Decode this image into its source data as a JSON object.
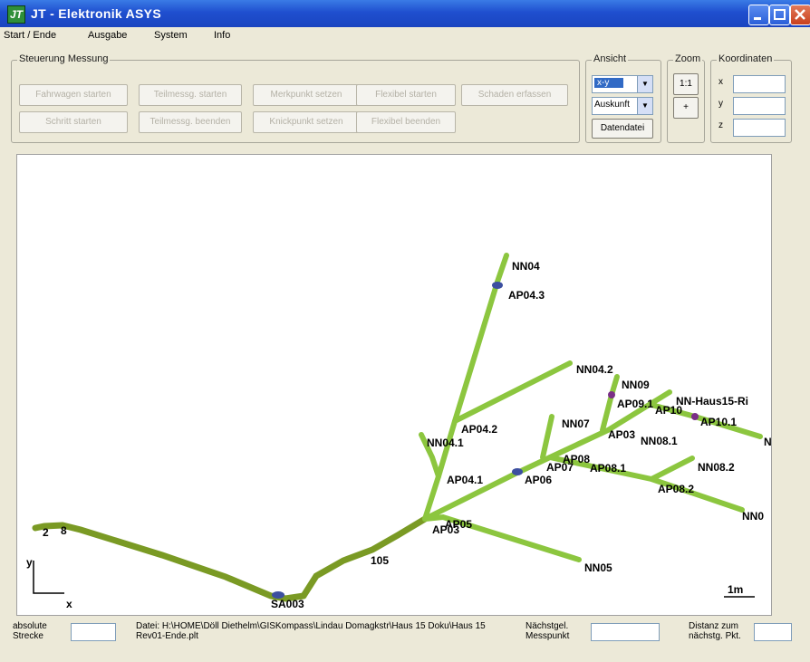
{
  "window": {
    "title": "JT - Elektronik  ASYS",
    "icon": "app-logo-icon",
    "controls": [
      "minimize-icon",
      "maximize-icon",
      "close-icon"
    ]
  },
  "menu": {
    "items": [
      "Start / Ende",
      "Ausgabe",
      "System",
      "Info"
    ]
  },
  "steuerung": {
    "label": "Steuerung Messung",
    "row1": [
      "Fahrwagen starten",
      "Teilmessg. starten",
      "Merkpunkt setzen",
      "Flexibel starten",
      "Schaden erfassen"
    ],
    "row2": [
      "Schritt starten",
      "Teilmessg. beenden",
      "Knickpunkt setzen",
      "Flexibel beenden"
    ]
  },
  "ansicht": {
    "label": "Ansicht",
    "projection": "x-y",
    "mode": "Auskunft",
    "datei_button": "Datendatei"
  },
  "zoom": {
    "label": "Zoom",
    "one_to_one": "1:1",
    "plus": "+"
  },
  "koordinaten": {
    "label": "Koordinaten",
    "axes": [
      "x",
      "y",
      "z"
    ],
    "values": [
      "",
      "",
      ""
    ]
  },
  "plot": {
    "colors": {
      "pipe": "#8cc63f",
      "main_pipe": "#7a9a24",
      "marker": "#3c4fa0",
      "marker2": "#7a2e86"
    },
    "axis_y": "y",
    "axis_x": "x",
    "scale": "1m",
    "labels": [
      "NN04",
      "AP04.3",
      "NN04.2",
      "NN09",
      "AP09.1",
      "NN-Haus15-Ri",
      "AP10",
      "AP10.1",
      "N",
      "NN07",
      "AP03",
      "NN08.1",
      "AP04.2",
      "NN04.1",
      "AP08",
      "AP07",
      "AP08.1",
      "NN08.2",
      "AP04.1",
      "AP06",
      "AP08.2",
      "NN0",
      "AP05",
      "AP03",
      "NN05",
      "105",
      "2",
      "8",
      "SA003"
    ]
  },
  "status": {
    "absolute_label": "absolute\nStrecke",
    "absolute_value": "",
    "file_text": "Datei: H:\\HOME\\Döll Diethelm\\GISKompass\\Lindau Domagkstr\\Haus 15 Doku\\Haus 15 Rev01-Ende.plt",
    "naechst_label": "Nächstgel.\nMesspunkt",
    "naechst_value": "",
    "distanz_label": "Distanz zum\nnächstg. Pkt.",
    "distanz_value": ""
  }
}
